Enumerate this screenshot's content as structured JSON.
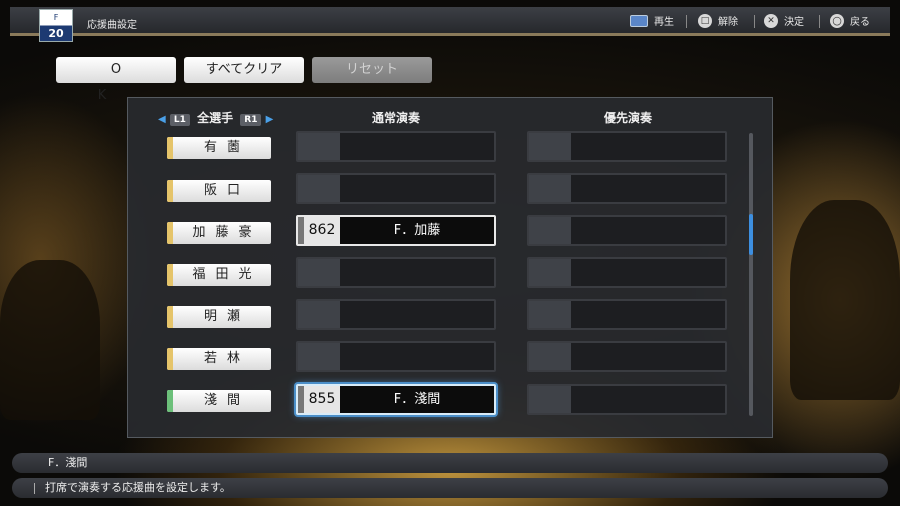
{
  "header": {
    "logo_top": "F",
    "logo_number": "20",
    "title": "応援曲設定",
    "controls": [
      {
        "icon": "book-icon",
        "label": "再生"
      },
      {
        "icon": "square-button-icon",
        "label": "解除"
      },
      {
        "icon": "cross-button-icon",
        "label": "決定"
      },
      {
        "icon": "circle-button-icon",
        "label": "戻る"
      }
    ]
  },
  "buttons": {
    "ok": "O K",
    "clear_all": "すべてクリア",
    "reset": "リセット"
  },
  "table": {
    "filter": {
      "left_button": "L1",
      "label": "全選手",
      "right_button": "R1"
    },
    "col_normal": "通常演奏",
    "col_priority": "優先演奏",
    "rows": [
      {
        "player": "有薗",
        "normal": null,
        "priority": null
      },
      {
        "player": "阪口",
        "normal": null,
        "priority": null
      },
      {
        "player": "加藤豪",
        "normal": {
          "number": "862",
          "song": "F．加藤"
        },
        "priority": null
      },
      {
        "player": "福田光",
        "normal": null,
        "priority": null
      },
      {
        "player": "明瀬",
        "normal": null,
        "priority": null
      },
      {
        "player": "若林",
        "normal": null,
        "priority": null
      },
      {
        "player": "淺間",
        "normal": {
          "number": "855",
          "song": "F．淺間"
        },
        "priority": null
      }
    ]
  },
  "info": {
    "selected_song": "F．淺間",
    "description": "打席で演奏する応援曲を設定します。"
  },
  "colors": {
    "accent_blue": "#3d8fe0",
    "player_tab_gold": "#e5c46a",
    "player_tab_green": "#6cc07a"
  }
}
